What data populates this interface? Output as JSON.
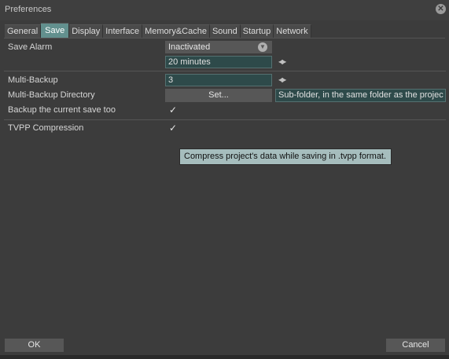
{
  "window": {
    "title": "Preferences"
  },
  "tabs": [
    {
      "label": "General",
      "active": false
    },
    {
      "label": "Save",
      "active": true
    },
    {
      "label": "Display",
      "active": false
    },
    {
      "label": "Interface",
      "active": false
    },
    {
      "label": "Memory&Cache",
      "active": false
    },
    {
      "label": "Sound",
      "active": false
    },
    {
      "label": "Startup",
      "active": false
    },
    {
      "label": "Network",
      "active": false
    }
  ],
  "save_alarm": {
    "label": "Save Alarm",
    "mode": "Inactivated",
    "interval": "20 minutes"
  },
  "multi_backup": {
    "label": "Multi-Backup",
    "value": "3"
  },
  "backup_dir": {
    "label": "Multi-Backup Directory",
    "button": "Set...",
    "path": "Sub-folder, in the same folder as the projec"
  },
  "backup_current": {
    "label": "Backup the current save too",
    "checked": true
  },
  "tvpp": {
    "label": "TVPP Compression",
    "checked": true
  },
  "tooltip": "Compress project's data while saving in .tvpp format.",
  "footer": {
    "ok": "OK",
    "cancel": "Cancel"
  }
}
